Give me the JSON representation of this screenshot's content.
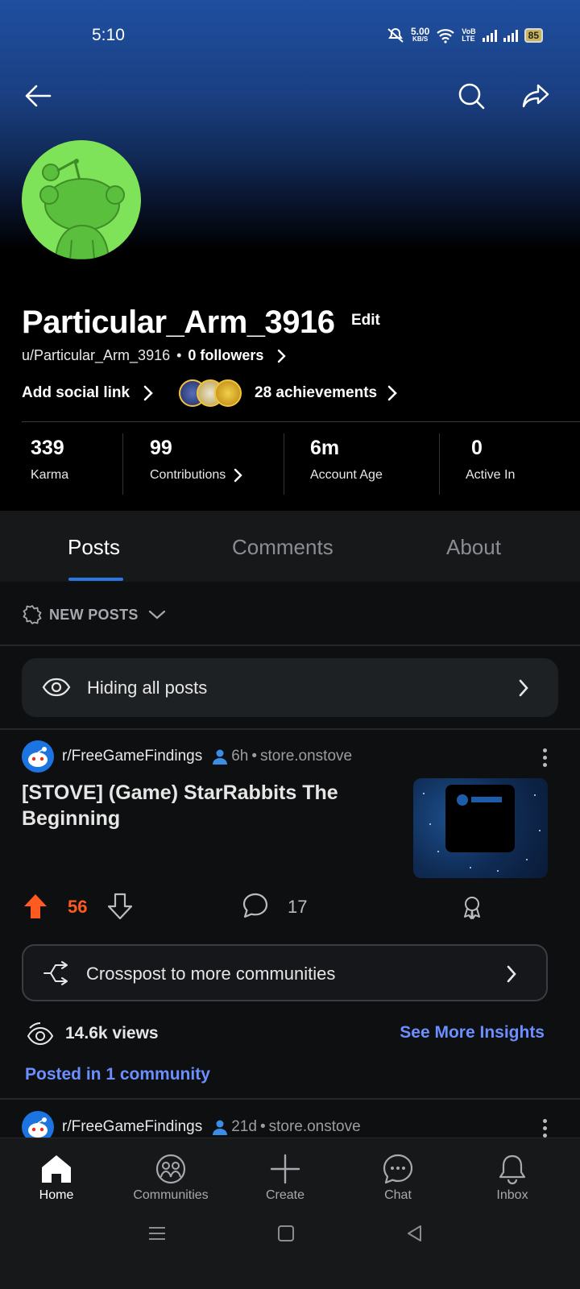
{
  "status_bar": {
    "time": "5:10",
    "net_speed_value": "5.00",
    "net_speed_unit": "KB/S",
    "network_label_top": "VoB",
    "network_label_bottom": "LTE",
    "battery": "85"
  },
  "profile": {
    "display_name": "Particular_Arm_3916",
    "edit_label": "Edit",
    "handle": "u/Particular_Arm_3916",
    "followers": "0 followers",
    "add_social_link": "Add social link",
    "achievements": "28 achievements",
    "avatar_color": "#7fe35a"
  },
  "stats": [
    {
      "value": "339",
      "label": "Karma"
    },
    {
      "value": "99",
      "label": "Contributions"
    },
    {
      "value": "6m",
      "label": "Account Age"
    },
    {
      "value": "0",
      "label": "Active In"
    }
  ],
  "tabs": [
    {
      "label": "Posts",
      "active": true
    },
    {
      "label": "Comments",
      "active": false
    },
    {
      "label": "About",
      "active": false
    }
  ],
  "sort_label": "NEW POSTS",
  "hiding_label": "Hiding all posts",
  "posts": [
    {
      "subreddit": "r/FreeGameFindings",
      "age": "6h",
      "domain": "store.onstove",
      "title": "[STOVE] (Game) StarRabbits The Beginning",
      "score": "56",
      "comments": "17"
    },
    {
      "subreddit": "r/FreeGameFindings",
      "age": "21d",
      "domain": "store.onstove"
    }
  ],
  "crosspost_label": "Crosspost to more communities",
  "views": "14.6k views",
  "insights_label": "See More Insights",
  "posted_in": "Posted in 1 community",
  "bottom_nav": [
    {
      "label": "Home",
      "active": true
    },
    {
      "label": "Communities",
      "active": false
    },
    {
      "label": "Create",
      "active": false
    },
    {
      "label": "Chat",
      "active": false
    },
    {
      "label": "Inbox",
      "active": false
    }
  ],
  "colors": {
    "accent_blue": "#2a78e4",
    "upvote_orange": "#ff5a1f",
    "link_blue": "#6c8fff"
  }
}
